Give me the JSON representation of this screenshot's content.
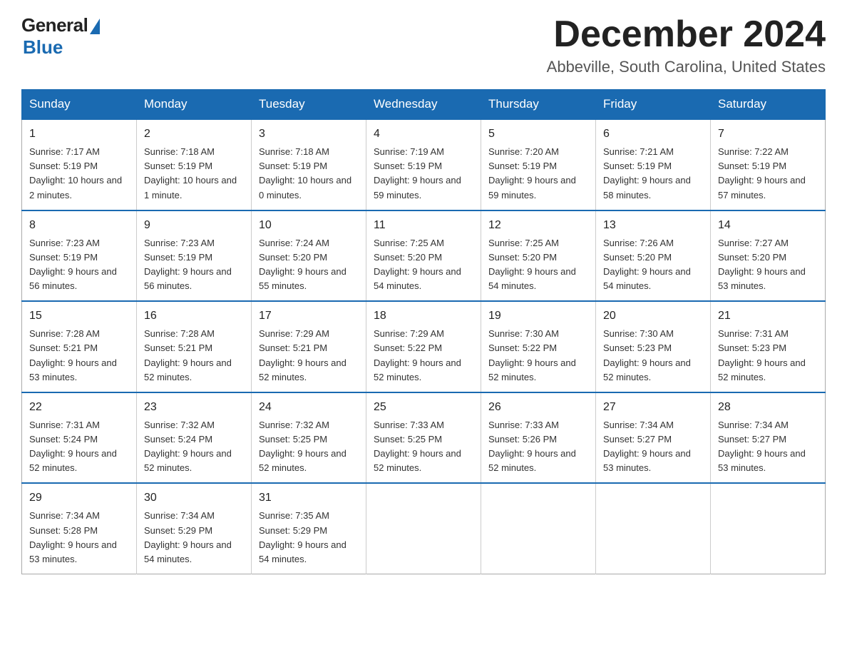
{
  "logo": {
    "general": "General",
    "blue": "Blue"
  },
  "title": {
    "month_year": "December 2024",
    "location": "Abbeville, South Carolina, United States"
  },
  "weekdays": [
    "Sunday",
    "Monday",
    "Tuesday",
    "Wednesday",
    "Thursday",
    "Friday",
    "Saturday"
  ],
  "weeks": [
    [
      {
        "day": "1",
        "sunrise": "7:17 AM",
        "sunset": "5:19 PM",
        "daylight": "10 hours and 2 minutes."
      },
      {
        "day": "2",
        "sunrise": "7:18 AM",
        "sunset": "5:19 PM",
        "daylight": "10 hours and 1 minute."
      },
      {
        "day": "3",
        "sunrise": "7:18 AM",
        "sunset": "5:19 PM",
        "daylight": "10 hours and 0 minutes."
      },
      {
        "day": "4",
        "sunrise": "7:19 AM",
        "sunset": "5:19 PM",
        "daylight": "9 hours and 59 minutes."
      },
      {
        "day": "5",
        "sunrise": "7:20 AM",
        "sunset": "5:19 PM",
        "daylight": "9 hours and 59 minutes."
      },
      {
        "day": "6",
        "sunrise": "7:21 AM",
        "sunset": "5:19 PM",
        "daylight": "9 hours and 58 minutes."
      },
      {
        "day": "7",
        "sunrise": "7:22 AM",
        "sunset": "5:19 PM",
        "daylight": "9 hours and 57 minutes."
      }
    ],
    [
      {
        "day": "8",
        "sunrise": "7:23 AM",
        "sunset": "5:19 PM",
        "daylight": "9 hours and 56 minutes."
      },
      {
        "day": "9",
        "sunrise": "7:23 AM",
        "sunset": "5:19 PM",
        "daylight": "9 hours and 56 minutes."
      },
      {
        "day": "10",
        "sunrise": "7:24 AM",
        "sunset": "5:20 PM",
        "daylight": "9 hours and 55 minutes."
      },
      {
        "day": "11",
        "sunrise": "7:25 AM",
        "sunset": "5:20 PM",
        "daylight": "9 hours and 54 minutes."
      },
      {
        "day": "12",
        "sunrise": "7:25 AM",
        "sunset": "5:20 PM",
        "daylight": "9 hours and 54 minutes."
      },
      {
        "day": "13",
        "sunrise": "7:26 AM",
        "sunset": "5:20 PM",
        "daylight": "9 hours and 54 minutes."
      },
      {
        "day": "14",
        "sunrise": "7:27 AM",
        "sunset": "5:20 PM",
        "daylight": "9 hours and 53 minutes."
      }
    ],
    [
      {
        "day": "15",
        "sunrise": "7:28 AM",
        "sunset": "5:21 PM",
        "daylight": "9 hours and 53 minutes."
      },
      {
        "day": "16",
        "sunrise": "7:28 AM",
        "sunset": "5:21 PM",
        "daylight": "9 hours and 52 minutes."
      },
      {
        "day": "17",
        "sunrise": "7:29 AM",
        "sunset": "5:21 PM",
        "daylight": "9 hours and 52 minutes."
      },
      {
        "day": "18",
        "sunrise": "7:29 AM",
        "sunset": "5:22 PM",
        "daylight": "9 hours and 52 minutes."
      },
      {
        "day": "19",
        "sunrise": "7:30 AM",
        "sunset": "5:22 PM",
        "daylight": "9 hours and 52 minutes."
      },
      {
        "day": "20",
        "sunrise": "7:30 AM",
        "sunset": "5:23 PM",
        "daylight": "9 hours and 52 minutes."
      },
      {
        "day": "21",
        "sunrise": "7:31 AM",
        "sunset": "5:23 PM",
        "daylight": "9 hours and 52 minutes."
      }
    ],
    [
      {
        "day": "22",
        "sunrise": "7:31 AM",
        "sunset": "5:24 PM",
        "daylight": "9 hours and 52 minutes."
      },
      {
        "day": "23",
        "sunrise": "7:32 AM",
        "sunset": "5:24 PM",
        "daylight": "9 hours and 52 minutes."
      },
      {
        "day": "24",
        "sunrise": "7:32 AM",
        "sunset": "5:25 PM",
        "daylight": "9 hours and 52 minutes."
      },
      {
        "day": "25",
        "sunrise": "7:33 AM",
        "sunset": "5:25 PM",
        "daylight": "9 hours and 52 minutes."
      },
      {
        "day": "26",
        "sunrise": "7:33 AM",
        "sunset": "5:26 PM",
        "daylight": "9 hours and 52 minutes."
      },
      {
        "day": "27",
        "sunrise": "7:34 AM",
        "sunset": "5:27 PM",
        "daylight": "9 hours and 53 minutes."
      },
      {
        "day": "28",
        "sunrise": "7:34 AM",
        "sunset": "5:27 PM",
        "daylight": "9 hours and 53 minutes."
      }
    ],
    [
      {
        "day": "29",
        "sunrise": "7:34 AM",
        "sunset": "5:28 PM",
        "daylight": "9 hours and 53 minutes."
      },
      {
        "day": "30",
        "sunrise": "7:34 AM",
        "sunset": "5:29 PM",
        "daylight": "9 hours and 54 minutes."
      },
      {
        "day": "31",
        "sunrise": "7:35 AM",
        "sunset": "5:29 PM",
        "daylight": "9 hours and 54 minutes."
      },
      null,
      null,
      null,
      null
    ]
  ],
  "labels": {
    "sunrise": "Sunrise:",
    "sunset": "Sunset:",
    "daylight": "Daylight:"
  }
}
